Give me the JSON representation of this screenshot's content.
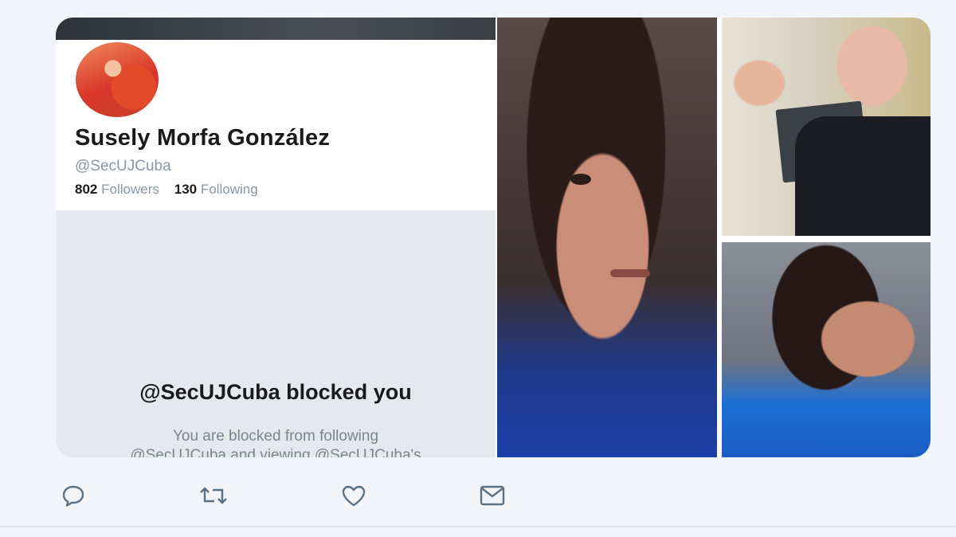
{
  "profile": {
    "display_name": "Susely Morfa González",
    "handle": "@SecUJCuba",
    "followers_count": "802",
    "followers_label": "Followers",
    "following_count": "130",
    "following_label": "Following",
    "blocked_title": "@SecUJCuba blocked you",
    "blocked_desc_line1": "You are blocked from following",
    "blocked_desc_line2": "@SecUJCuba and viewing @SecUJCuba's"
  },
  "actions": [
    {
      "name": "reply",
      "icon": "reply-icon"
    },
    {
      "name": "retweet",
      "icon": "retweet-icon"
    },
    {
      "name": "like",
      "icon": "heart-icon"
    },
    {
      "name": "share",
      "icon": "mail-icon"
    }
  ],
  "colors": {
    "muted_text": "#8a96a3",
    "icon": "#5b7083",
    "background": "#f1f4f8"
  }
}
